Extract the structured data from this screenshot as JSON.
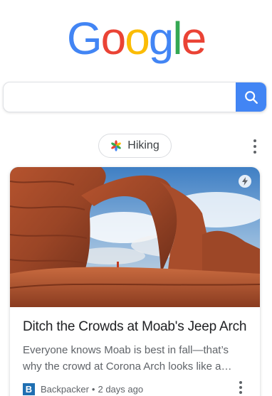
{
  "logo": {
    "letters": [
      "G",
      "o",
      "o",
      "g",
      "l",
      "e"
    ],
    "colors": [
      "#4285F4",
      "#EA4335",
      "#FBBC05",
      "#4285F4",
      "#34A853",
      "#EA4335"
    ]
  },
  "search": {
    "value": "",
    "placeholder": "",
    "button_icon": "search-icon",
    "button_color": "#4285F4"
  },
  "chip": {
    "label": "Hiking",
    "icon": "pinwheel-icon"
  },
  "menu_icon": "more-vert-icon",
  "card": {
    "title": "Ditch the Crowds at Moab's Jeep Arch",
    "snippet": "Everyone knows Moab is best in fall—that’s why the crowd at Corona Arch looks like a…",
    "source_logo_letter": "B",
    "source_name": "Backpacker",
    "separator": "•",
    "time_ago": "2 days ago",
    "badge_icon": "amp-lightning-icon",
    "image_alt": "Red rock sandstone arch under a cloudy blue sky",
    "more_icon": "more-vert-icon"
  }
}
